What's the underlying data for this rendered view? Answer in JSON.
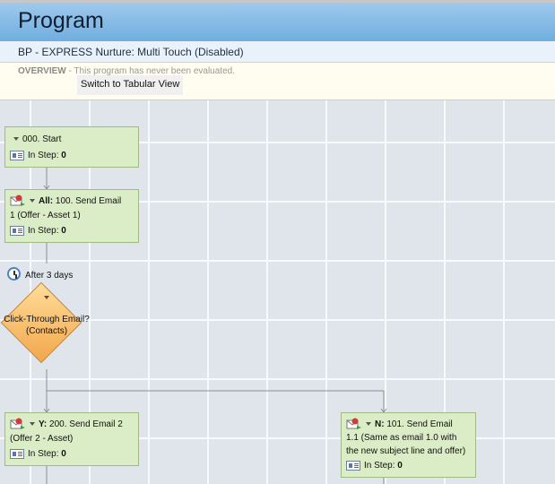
{
  "header": {
    "title": "Program",
    "program_name": "BP - EXPRESS Nurture: Multi Touch (Disabled)",
    "overview_label": "OVERVIEW",
    "overview_text": " - This program has never been evaluated.",
    "tabular_view_button": "Switch to Tabular View"
  },
  "flow": {
    "steps": [
      {
        "id": "start",
        "prefix": "",
        "label": "000. Start",
        "in_step_label": "In Step:",
        "in_step_value": "0"
      },
      {
        "id": "send-email-1",
        "prefix": "All:",
        "label": " 100. Send Email",
        "label2": "1 (Offer - Asset 1)",
        "in_step_label": "In Step:",
        "in_step_value": "0"
      },
      {
        "id": "send-email-2",
        "prefix": "Y:",
        "label": " 200. Send Email 2",
        "label2": "(Offer 2 - Asset)",
        "in_step_label": "In Step:",
        "in_step_value": "0"
      },
      {
        "id": "send-email-1-1",
        "prefix": "N:",
        "label": " 101. Send Email",
        "label2": "1.1 (Same as email 1.0 with",
        "label3": "the new subject line and offer)",
        "in_step_label": "In Step:",
        "in_step_value": "0"
      }
    ],
    "wait": {
      "label": "After 3 days"
    },
    "decision": {
      "line1": "Click-Through Email?",
      "line2": "(Contacts)"
    }
  },
  "colors": {
    "title_bar": "#7fb8e4",
    "step_fill": "#dbedc6",
    "decision_fill": "#f2a74b",
    "canvas_bg": "#dfe5ea"
  }
}
